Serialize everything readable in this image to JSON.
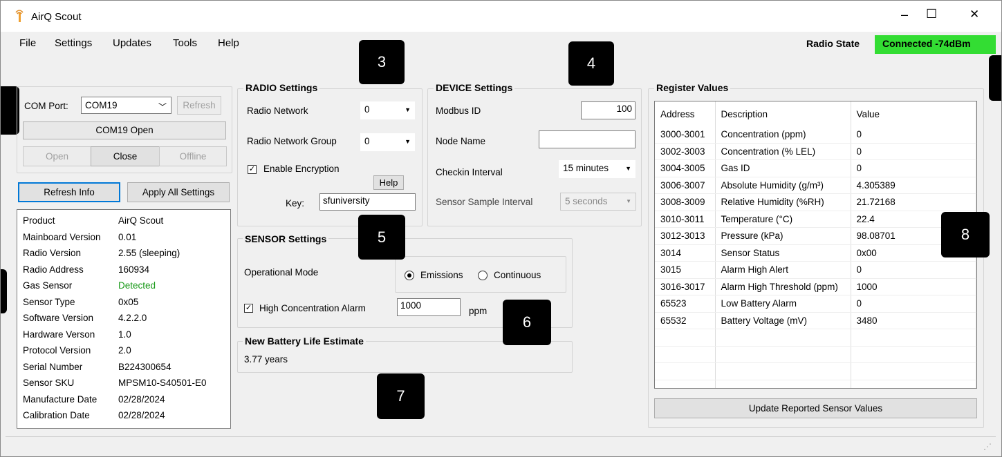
{
  "window": {
    "title": "AirQ Scout",
    "minimize": "–",
    "maximize": "☐",
    "close": "✕"
  },
  "menu": [
    "File",
    "Settings",
    "Updates",
    "Tools",
    "Help"
  ],
  "radio_state": {
    "label": "Radio State",
    "value": "Connected -74dBm",
    "color": "#33dd33"
  },
  "com": {
    "port_label": "COM Port:",
    "port_value": "COM19",
    "refresh": "Refresh",
    "status": "COM19 Open",
    "open": "Open",
    "close": "Close",
    "offline": "Offline"
  },
  "actions": {
    "refresh_info": "Refresh Info",
    "apply_all": "Apply All Settings"
  },
  "info": [
    {
      "key": "Product",
      "value": "AirQ Scout"
    },
    {
      "key": "Mainboard Version",
      "value": "0.01"
    },
    {
      "key": "Radio Version",
      "value": "2.55 (sleeping)"
    },
    {
      "key": "Radio Address",
      "value": "160934"
    },
    {
      "key": "Gas Sensor",
      "value": "Detected",
      "color": "#1a9a1a"
    },
    {
      "key": "Sensor Type",
      "value": "0x05"
    },
    {
      "key": "Software Version",
      "value": "4.2.2.0"
    },
    {
      "key": "Hardware Verson",
      "value": "1.0"
    },
    {
      "key": "Protocol Version",
      "value": "2.0"
    },
    {
      "key": "Serial Number",
      "value": "B224300654"
    },
    {
      "key": "Sensor SKU",
      "value": "MPSM10-S40501-E0"
    },
    {
      "key": "Manufacture Date",
      "value": "02/28/2024"
    },
    {
      "key": "Calibration Date",
      "value": "02/28/2024"
    }
  ],
  "radio": {
    "title": "RADIO Settings",
    "network_label": "Radio Network",
    "network_value": "0",
    "group_label": "Radio Network Group",
    "group_value": "0",
    "encryption_label": "Enable Encryption",
    "encryption_checked": true,
    "help": "Help",
    "key_label": "Key:",
    "key_value": "sfuniversity"
  },
  "device": {
    "title": "DEVICE Settings",
    "modbus_label": "Modbus ID",
    "modbus_value": "100",
    "node_label": "Node Name",
    "node_value": "",
    "checkin_label": "Checkin Interval",
    "checkin_value": "15 minutes",
    "sample_label": "Sensor Sample Interval",
    "sample_value": "5 seconds"
  },
  "sensor": {
    "title": "SENSOR Settings",
    "mode_label": "Operational Mode",
    "mode_emissions": "Emissions",
    "mode_continuous": "Continuous",
    "alarm_label": "High Concentration Alarm",
    "alarm_value": "1000",
    "alarm_unit": "ppm"
  },
  "battery": {
    "title": "New Battery Life Estimate",
    "value": "3.77 years"
  },
  "registers": {
    "title": "Register Values",
    "headers": [
      "Address",
      "Description",
      "Value"
    ],
    "rows": [
      [
        "3000-3001",
        "Concentration (ppm)",
        "0"
      ],
      [
        "3002-3003",
        "Concentration (% LEL)",
        "0"
      ],
      [
        "3004-3005",
        "Gas ID",
        "0"
      ],
      [
        "3006-3007",
        "Absolute Humidity (g/m³)",
        "4.305389"
      ],
      [
        "3008-3009",
        "Relative Humidity (%RH)",
        "21.72168"
      ],
      [
        "3010-3011",
        "Temperature (°C)",
        "22.4"
      ],
      [
        "3012-3013",
        "Pressure (kPa)",
        "98.08701"
      ],
      [
        "3014",
        "Sensor Status",
        "0x00"
      ],
      [
        "3015",
        "Alarm High Alert",
        "0"
      ],
      [
        "3016-3017",
        "Alarm High Threshold (ppm)",
        "1000"
      ],
      [
        "65523",
        "Low Battery Alarm",
        "0"
      ],
      [
        "65532",
        "Battery Voltage (mV)",
        "3480"
      ]
    ],
    "update_button": "Update Reported Sensor Values"
  },
  "callouts": [
    "3",
    "4",
    "5",
    "6",
    "7",
    "8"
  ]
}
